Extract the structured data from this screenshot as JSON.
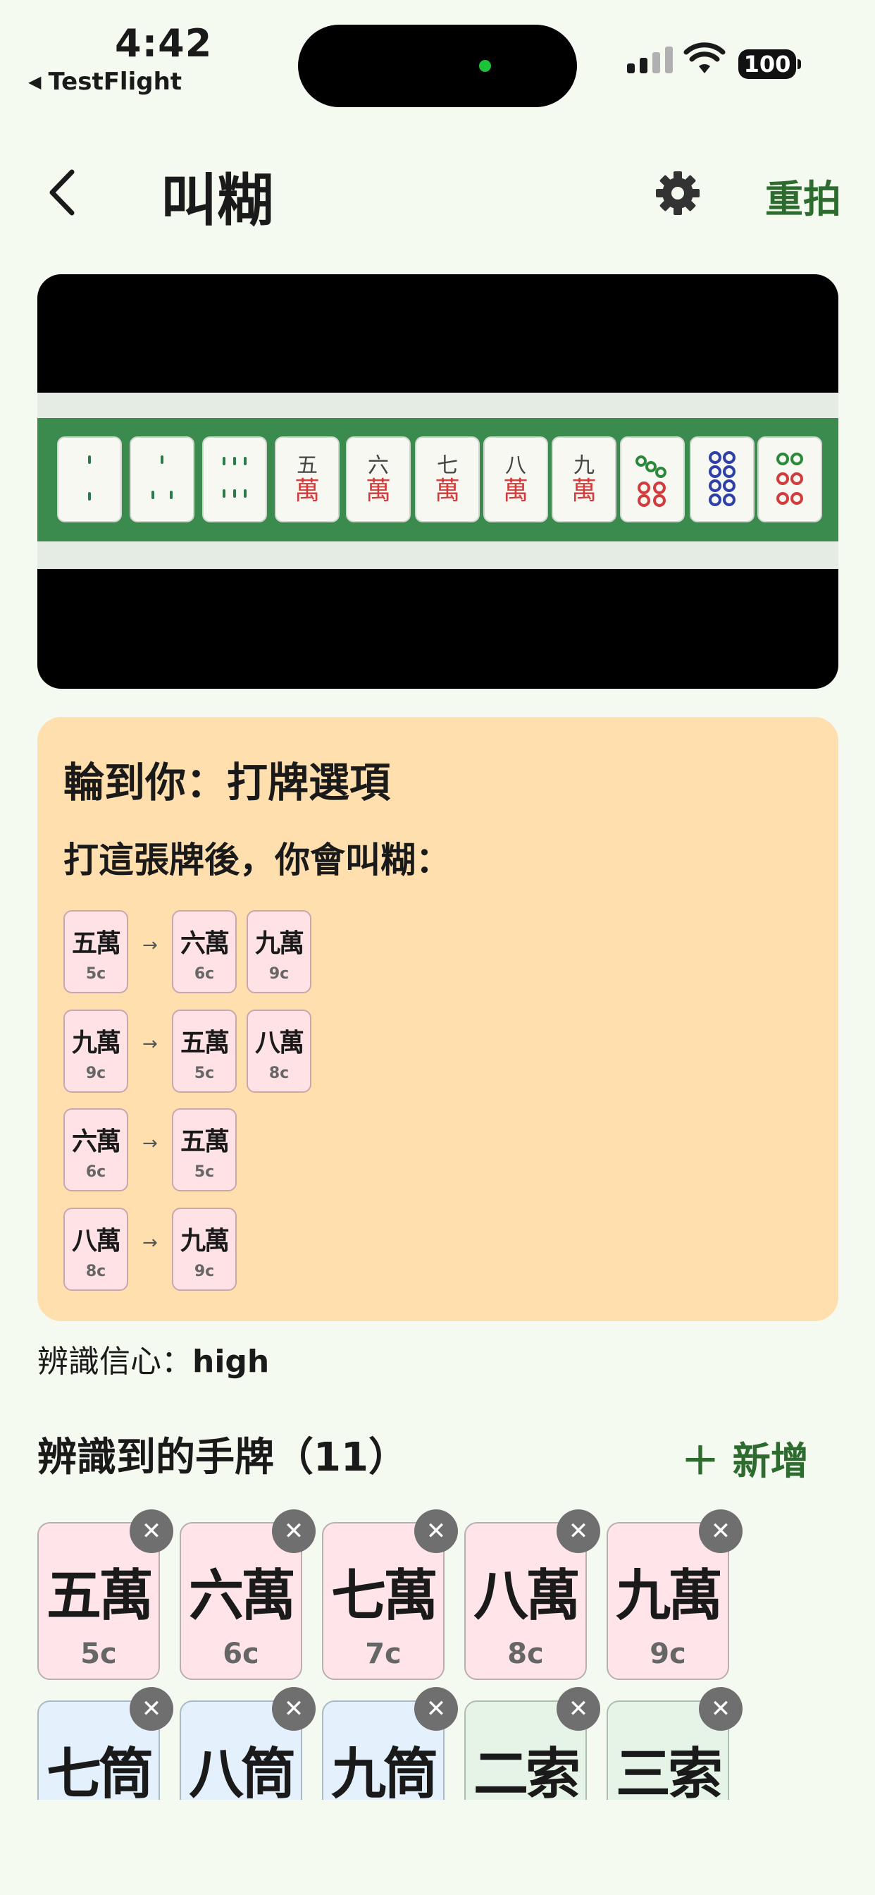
{
  "status": {
    "time": "4:42",
    "back_app": "TestFlight",
    "battery": "100"
  },
  "nav": {
    "title": "叫糊",
    "retake_label": "重拍"
  },
  "photo_tiles": [
    {
      "num": "",
      "wan": ""
    },
    {
      "num": "",
      "wan": ""
    },
    {
      "num": "",
      "wan": ""
    },
    {
      "num": "五",
      "wan": "萬"
    },
    {
      "num": "六",
      "wan": "萬"
    },
    {
      "num": "七",
      "wan": "萬"
    },
    {
      "num": "八",
      "wan": "萬"
    },
    {
      "num": "九",
      "wan": "萬"
    },
    {
      "num": "",
      "wan": ""
    },
    {
      "num": "",
      "wan": ""
    },
    {
      "num": "",
      "wan": ""
    }
  ],
  "options": {
    "title": "輪到你：打牌選項",
    "subtitle": "打這張牌後，你會叫糊：",
    "arrow": "→",
    "rows": [
      {
        "discard": {
          "name": "五萬",
          "code": "5c"
        },
        "waits": [
          {
            "name": "六萬",
            "code": "6c"
          },
          {
            "name": "九萬",
            "code": "9c"
          }
        ]
      },
      {
        "discard": {
          "name": "九萬",
          "code": "9c"
        },
        "waits": [
          {
            "name": "五萬",
            "code": "5c"
          },
          {
            "name": "八萬",
            "code": "8c"
          }
        ]
      },
      {
        "discard": {
          "name": "六萬",
          "code": "6c"
        },
        "waits": [
          {
            "name": "五萬",
            "code": "5c"
          }
        ]
      },
      {
        "discard": {
          "name": "八萬",
          "code": "8c"
        },
        "waits": [
          {
            "name": "九萬",
            "code": "9c"
          }
        ]
      }
    ]
  },
  "confidence": {
    "label": "辨識信心：",
    "value": "high"
  },
  "hand": {
    "title": "辨識到的手牌（11）",
    "add_label": "＋ 新增",
    "remove_glyph": "✕",
    "tiles": [
      {
        "name": "五萬",
        "code": "5c",
        "suit": "wan"
      },
      {
        "name": "六萬",
        "code": "6c",
        "suit": "wan"
      },
      {
        "name": "七萬",
        "code": "7c",
        "suit": "wan"
      },
      {
        "name": "八萬",
        "code": "8c",
        "suit": "wan"
      },
      {
        "name": "九萬",
        "code": "9c",
        "suit": "wan"
      },
      {
        "name": "七筒",
        "code": "",
        "suit": "tong"
      },
      {
        "name": "八筒",
        "code": "",
        "suit": "tong"
      },
      {
        "name": "九筒",
        "code": "",
        "suit": "tong"
      },
      {
        "name": "二索",
        "code": "",
        "suit": "suo"
      },
      {
        "name": "三索",
        "code": "",
        "suit": "suo"
      }
    ]
  },
  "colors": {
    "accent": "#2E6B2E",
    "card": "#FFDFAE",
    "background": "#F5FAF0"
  }
}
